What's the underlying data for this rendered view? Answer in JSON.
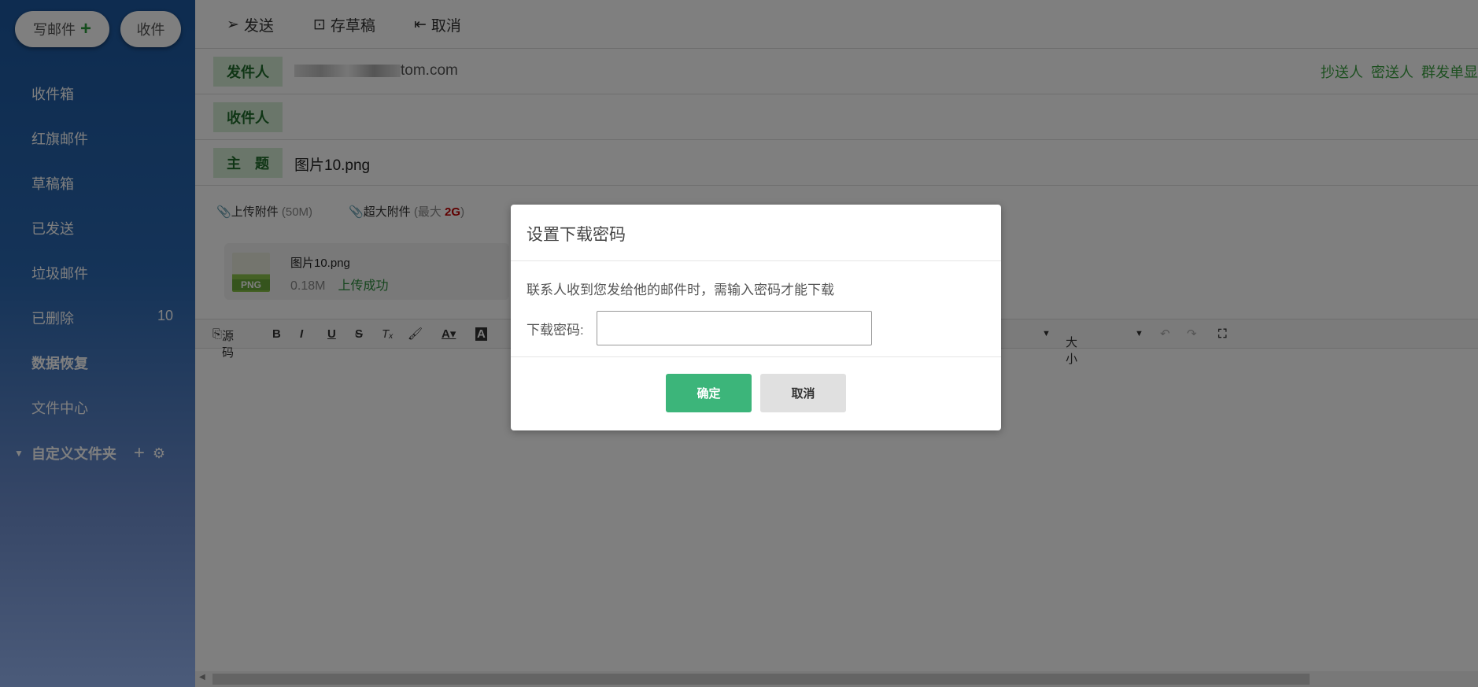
{
  "sidebar": {
    "compose": "写邮件",
    "receive": "收件",
    "items": [
      {
        "label": "收件箱",
        "count": ""
      },
      {
        "label": "红旗邮件",
        "count": ""
      },
      {
        "label": "草稿箱",
        "count": ""
      },
      {
        "label": "已发送",
        "count": ""
      },
      {
        "label": "垃圾邮件",
        "count": ""
      },
      {
        "label": "已删除",
        "count": "10"
      },
      {
        "label": "数据恢复",
        "count": ""
      },
      {
        "label": "文件中心",
        "count": ""
      }
    ],
    "custom_folders": "自定义文件夹"
  },
  "toolbar": {
    "send": "发送",
    "save_draft": "存草稿",
    "cancel": "取消"
  },
  "compose": {
    "from_label": "发件人",
    "from_value": "tom.com",
    "to_label": "收件人",
    "subject_label": "主　题",
    "subject_value": "图片10.png",
    "cc": "抄送人",
    "bcc": "密送人",
    "group_send": "群发单显"
  },
  "attachments": {
    "upload": "上传附件",
    "upload_limit": "(50M)",
    "large": "超大附件",
    "large_prefix": "(最大",
    "large_size": "2G",
    "large_suffix": ")",
    "file": {
      "name": "图片10.png",
      "size": "0.18M",
      "status": "上传成功",
      "type": "PNG"
    }
  },
  "editor": {
    "source": "源码",
    "size": "大小"
  },
  "modal": {
    "title": "设置下载密码",
    "message": "联系人收到您发给他的邮件时，需输入密码才能下载",
    "password_label": "下载密码:",
    "password_value": "",
    "confirm": "确定",
    "cancel": "取消"
  },
  "colors": {
    "accent": "#3cb57a",
    "label_green": "#1f6b2a",
    "link_green": "#3aa040",
    "danger": "#c00000"
  }
}
